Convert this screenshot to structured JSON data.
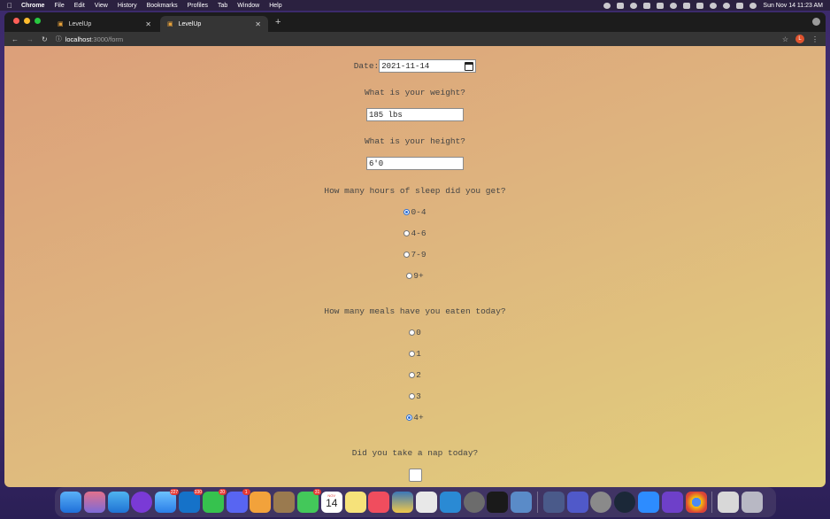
{
  "menubar": {
    "app": "Chrome",
    "items": [
      "File",
      "Edit",
      "View",
      "History",
      "Bookmarks",
      "Profiles",
      "Tab",
      "Window",
      "Help"
    ],
    "clock": "Sun Nov 14  11:23 AM"
  },
  "browser": {
    "tabs": [
      {
        "title": "LevelUp",
        "favicon": "levelup-favicon",
        "active": false
      },
      {
        "title": "LevelUp",
        "favicon": "levelup-favicon",
        "active": true
      }
    ],
    "url_host": "localhost",
    "url_path": ":3000/form",
    "profile_initial": "L"
  },
  "form": {
    "date_label": "Date:",
    "date_value": "2021-11-14",
    "weight_question": "What is your weight?",
    "weight_value": "185 lbs",
    "height_question": "What is your height?",
    "height_value": "6'0",
    "sleep_question": "How many hours of sleep did you get?",
    "sleep_options": [
      {
        "label": "0-4",
        "checked": true
      },
      {
        "label": "4-6",
        "checked": false
      },
      {
        "label": "7-9",
        "checked": false
      },
      {
        "label": "9+",
        "checked": false
      }
    ],
    "meals_question": "How many meals have you eaten today?",
    "meals_options": [
      {
        "label": "0",
        "checked": false
      },
      {
        "label": "1",
        "checked": false
      },
      {
        "label": "2",
        "checked": false
      },
      {
        "label": "3",
        "checked": false
      },
      {
        "label": "4+",
        "checked": true
      }
    ],
    "nap_question": "Did you take a nap today?",
    "nap_checked": false
  },
  "dock": {
    "badges": {
      "mail": "227",
      "outlook": "330",
      "facetime": "20",
      "discord": "1",
      "messages": "31"
    },
    "calendar_month": "NOV",
    "calendar_day": "14"
  },
  "colors": {
    "accent": "#2b6fd6",
    "page_gradient_start": "#dc9f7a",
    "page_gradient_end": "#e2d07c"
  }
}
